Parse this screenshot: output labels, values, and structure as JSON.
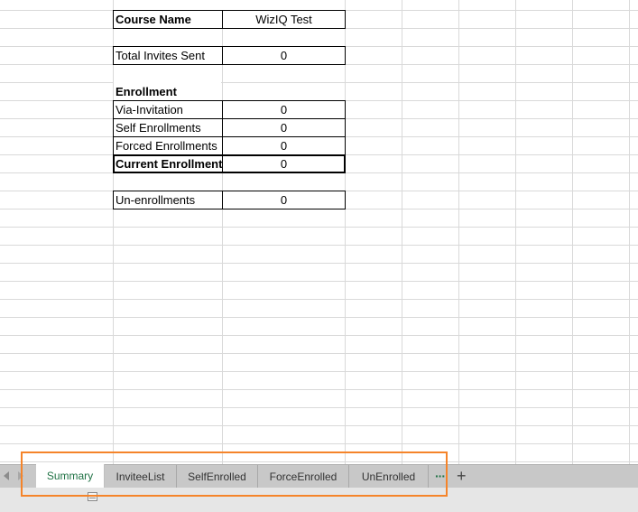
{
  "summary_table": {
    "course_name_label": "Course Name",
    "course_name_value": "WizIQ Test",
    "total_invites_label": "Total Invites Sent",
    "total_invites_value": "0",
    "enrollment_heading": "Enrollment",
    "via_invitation_label": "Via-Invitation",
    "via_invitation_value": "0",
    "self_enrollments_label": "Self Enrollments",
    "self_enrollments_value": "0",
    "forced_enrollments_label": "Forced Enrollments",
    "forced_enrollments_value": "0",
    "current_enrollment_label": "Current Enrollment",
    "current_enrollment_value": "0",
    "unenrollments_label": "Un-enrollments",
    "unenrollments_value": "0"
  },
  "sheet_tabs": {
    "tabs": [
      "Summary",
      "InviteeList",
      "SelfEnrolled",
      "ForceEnrolled",
      "UnEnrolled"
    ],
    "active": "Summary",
    "more_glyph": "···",
    "add_glyph": "+"
  },
  "colors": {
    "active_tab_text": "#217346",
    "highlight_box": "#f5842a",
    "gridline": "#d9d9d9"
  },
  "icons": {
    "nav_prev": "triangle-left-icon",
    "nav_next": "triangle-right-icon",
    "status": "sheet-view-icon"
  }
}
